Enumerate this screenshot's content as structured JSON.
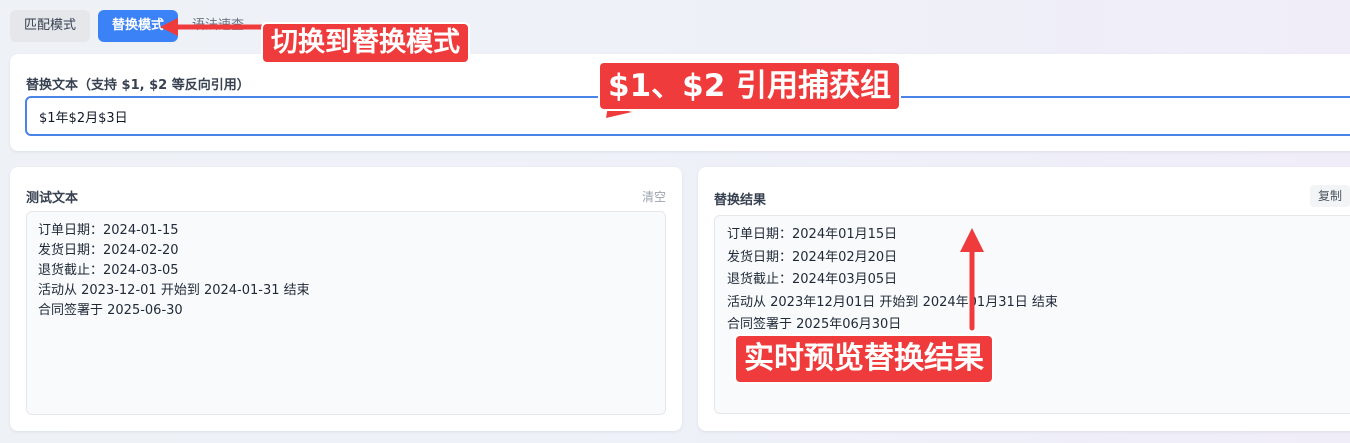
{
  "tabs": [
    {
      "label": "匹配模式"
    },
    {
      "label": "替换模式"
    },
    {
      "label": "语法速查"
    }
  ],
  "replace": {
    "label": "替换文本（支持 $1, $2 等反向引用）",
    "value": "$1年$2月$3日"
  },
  "test": {
    "title": "测试文本",
    "clear_label": "清空",
    "lines": [
      "订单日期：2024-01-15",
      "发货日期：2024-02-20",
      "退货截止：2024-03-05",
      "活动从 2023-12-01 开始到 2024-01-31 结束",
      "合同签署于 2025-06-30"
    ]
  },
  "result": {
    "title": "替换结果",
    "copy_label": "复制",
    "lines": [
      "订单日期：2024年01月15日",
      "发货日期：2024年02月20日",
      "退货截止：2024年03月05日",
      "活动从 2023年12月01日 开始到 2024年01月31日 结束",
      "合同签署于 2025年06月30日"
    ]
  },
  "annotations": {
    "tab_callout": "切换到替换模式",
    "input_callout": "$1、$2 引用捕获组",
    "result_callout": "实时预览替换结果",
    "color": "#ef3b3b"
  },
  "colors": {
    "accent": "#3b82f6",
    "input_border": "#4a84e8"
  }
}
